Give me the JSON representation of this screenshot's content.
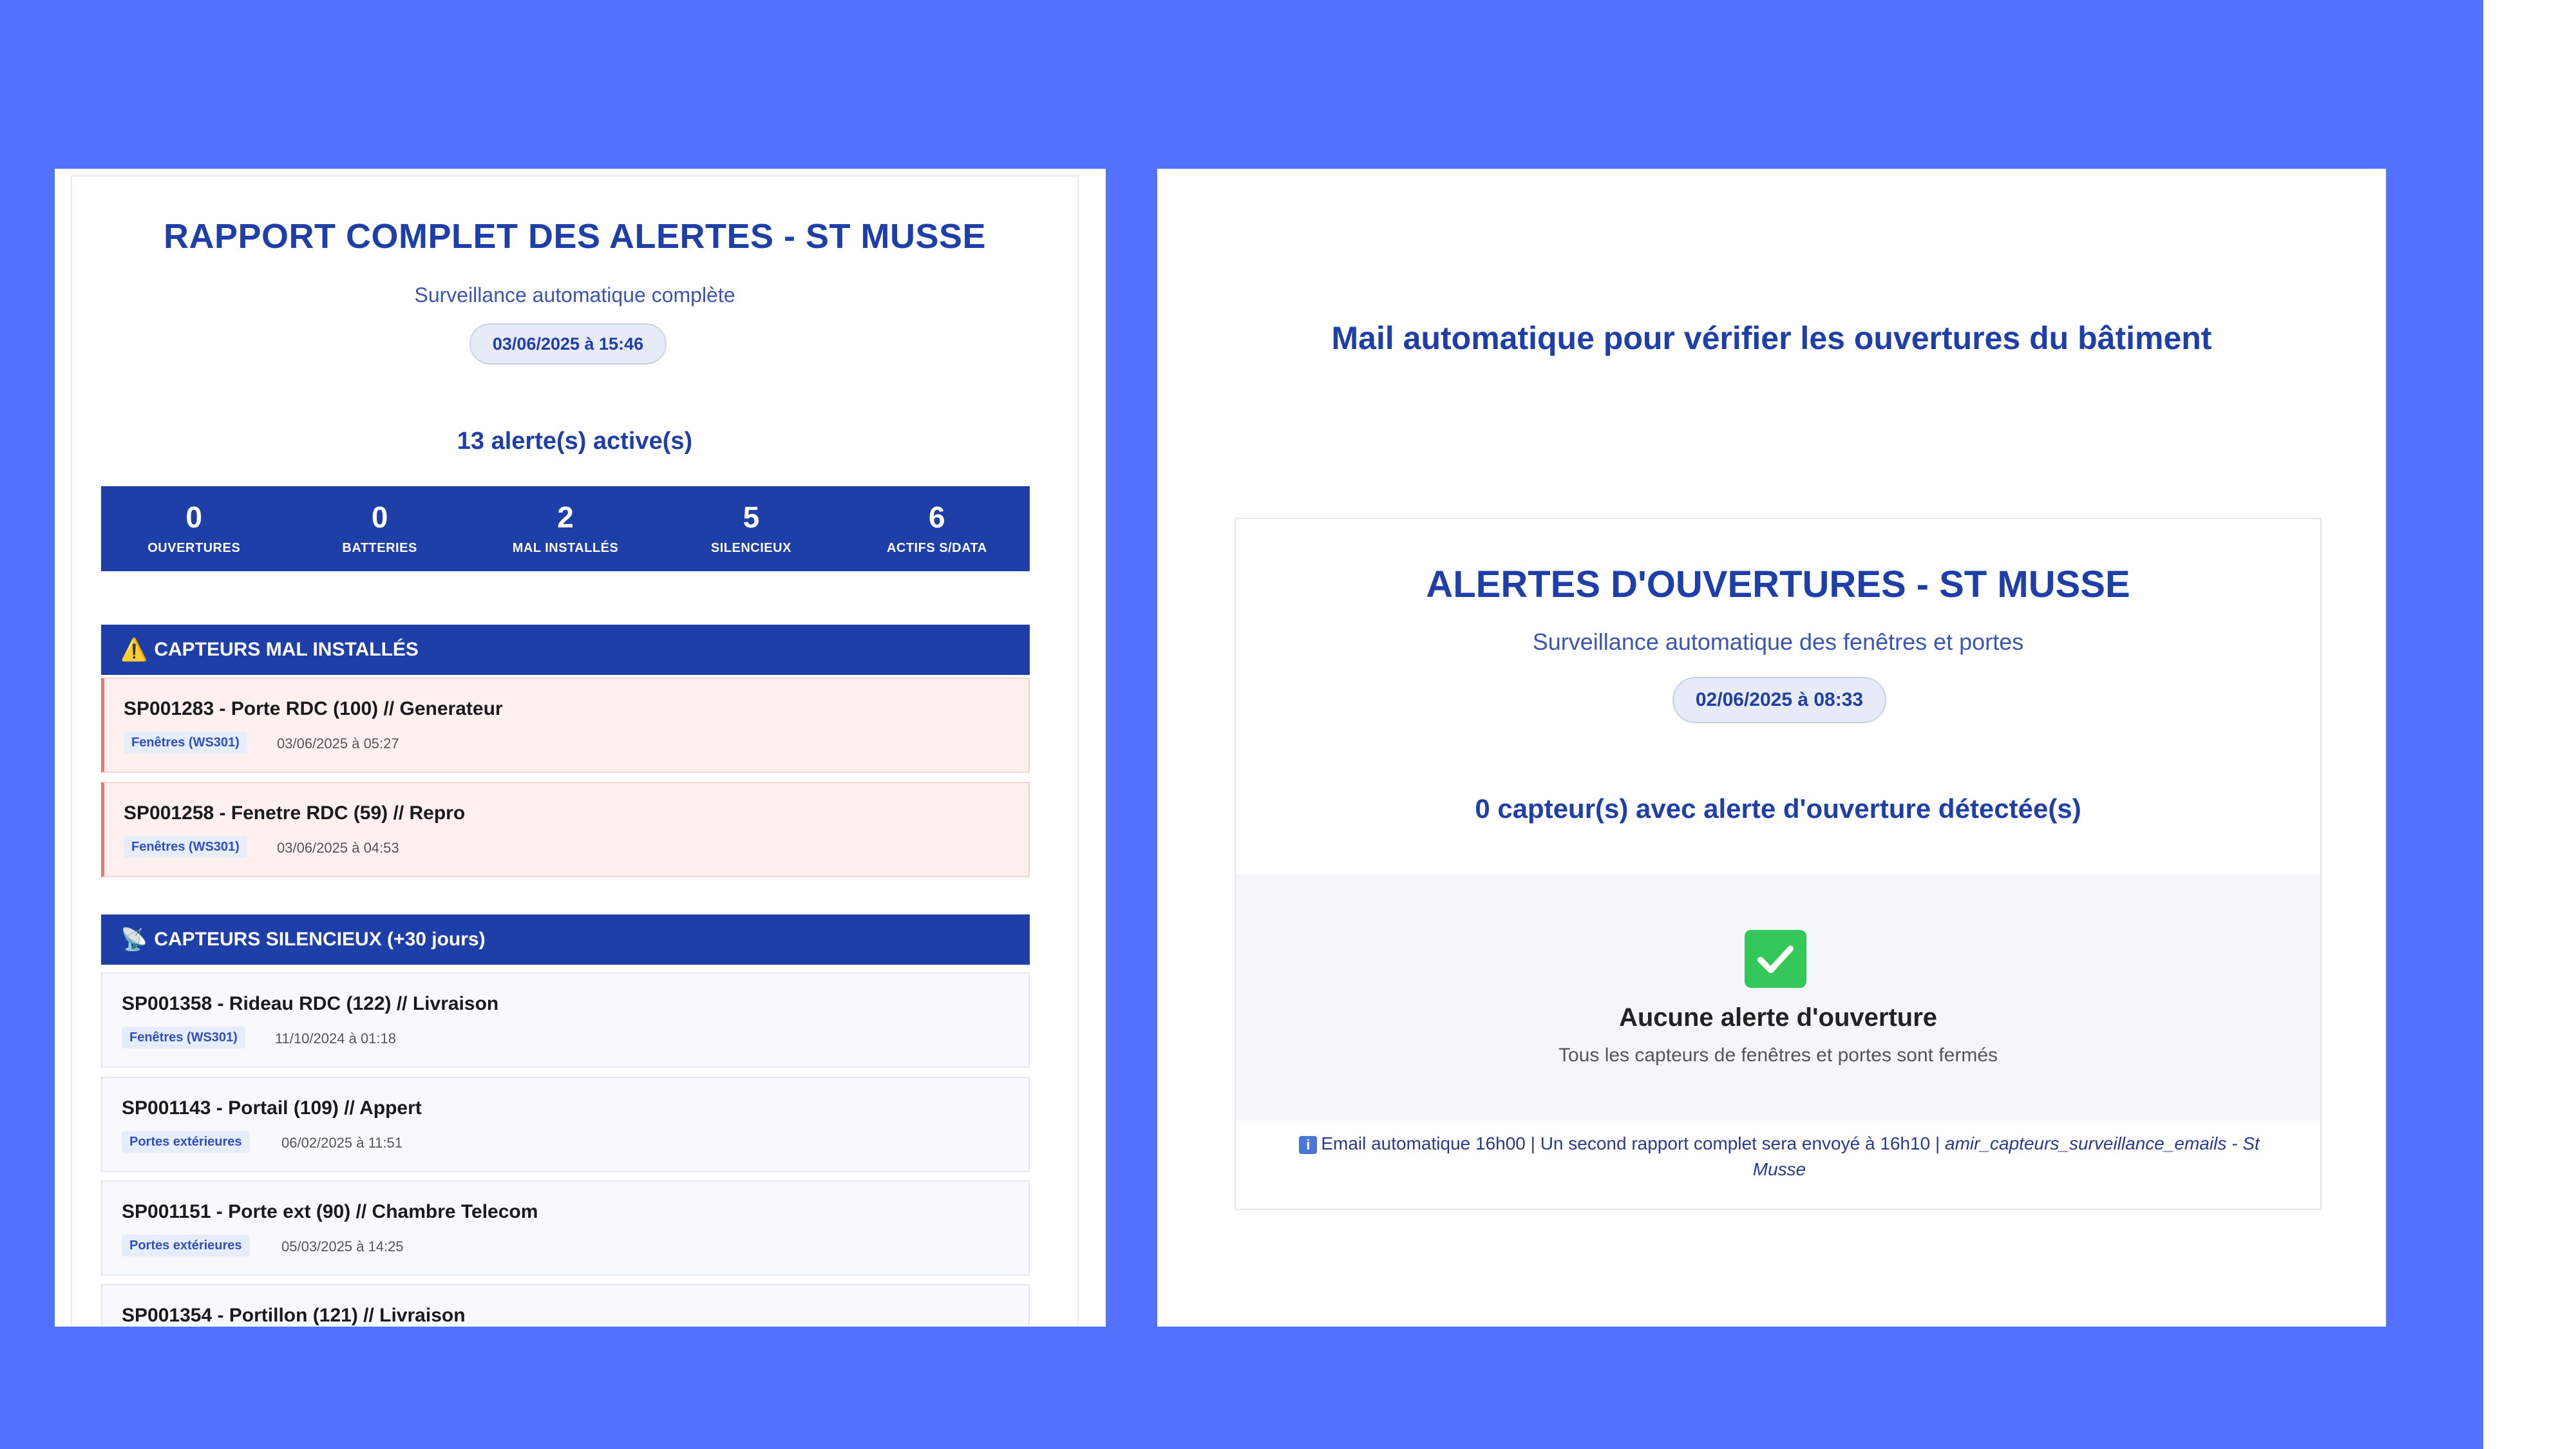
{
  "left": {
    "title": "RAPPORT COMPLET DES ALERTES - ST MUSSE",
    "subtitle": "Surveillance automatique complète",
    "date": "03/06/2025 à 15:46",
    "active_count": "13 alerte(s) active(s)",
    "stats": [
      {
        "value": "0",
        "label": "OUVERTURES"
      },
      {
        "value": "0",
        "label": "BATTERIES"
      },
      {
        "value": "2",
        "label": "MAL INSTALLÉS"
      },
      {
        "value": "5",
        "label": "SILENCIEUX"
      },
      {
        "value": "6",
        "label": "ACTIFS S/DATA"
      }
    ],
    "section_mal": {
      "icon": "⚠️",
      "label": "CAPTEURS MAL INSTALLÉS"
    },
    "mal_items": [
      {
        "title": "SP001283 - Porte RDC (100) // Generateur",
        "tag": "Fenêtres (WS301)",
        "date": "03/06/2025 à 05:27"
      },
      {
        "title": "SP001258 - Fenetre RDC (59) // Repro",
        "tag": "Fenêtres (WS301)",
        "date": "03/06/2025 à 04:53"
      }
    ],
    "section_sil": {
      "icon": "📡",
      "label": "CAPTEURS SILENCIEUX (+30 jours)"
    },
    "sil_items": [
      {
        "title": "SP001358 - Rideau RDC (122) // Livraison",
        "tag": "Fenêtres (WS301)",
        "date": "11/10/2024 à 01:18"
      },
      {
        "title": "SP001143 - Portail (109) // Appert",
        "tag": "Portes extérieures",
        "date": "06/02/2025 à 11:51"
      },
      {
        "title": "SP001151 - Porte ext (90) // Chambre Telecom",
        "tag": "Portes extérieures",
        "date": "05/03/2025 à 14:25"
      },
      {
        "title": "SP001354 - Portillon (121) // Livraison",
        "tag": "",
        "date": ""
      }
    ]
  },
  "right": {
    "headline": "Mail automatique pour vérifier les ouvertures du bâtiment",
    "title": "ALERTES D'OUVERTURES - ST MUSSE",
    "subtitle": "Surveillance automatique des fenêtres et portes",
    "date": "02/06/2025 à 08:33",
    "count": "0 capteur(s) avec alerte d'ouverture détectée(s)",
    "none_title": "Aucune alerte d'ouverture",
    "none_sub": "Tous les capteurs de fenêtres et portes sont fermés",
    "footer_text": "Email automatique 16h00 | Un second rapport complet sera envoyé à 16h10 | ",
    "footer_italic": "amir_capteurs_surveillance_emails - St Musse",
    "info_glyph": "i"
  },
  "colors": {
    "background": "#5271ff",
    "primary": "#1f3fa8",
    "warn_card": "#fdf0ef",
    "success": "#34c759"
  }
}
